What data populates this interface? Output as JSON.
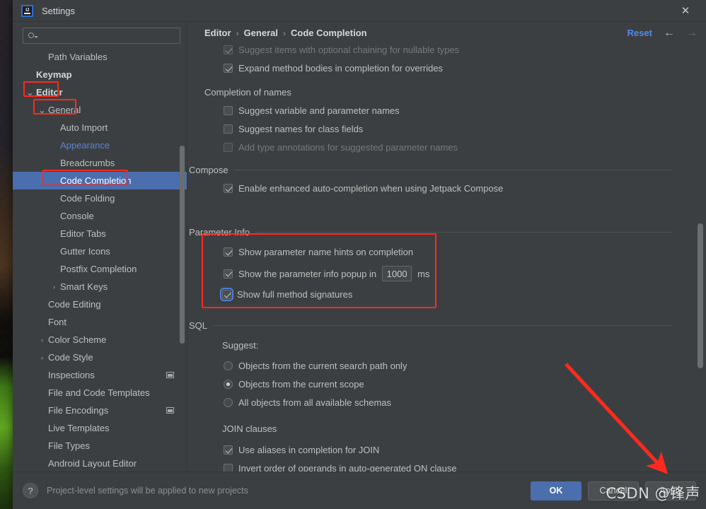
{
  "window": {
    "title": "Settings",
    "logo_text": "IJ",
    "close_icon": "✕"
  },
  "search": {
    "value": "",
    "placeholder": ""
  },
  "sidebar": {
    "items": [
      {
        "label": "Path Variables",
        "indent": 1,
        "arrow": "none",
        "style": "normal"
      },
      {
        "label": "Keymap",
        "indent": 0,
        "arrow": "none",
        "style": "bold"
      },
      {
        "label": "Editor",
        "indent": 0,
        "arrow": "down",
        "style": "bold"
      },
      {
        "label": "General",
        "indent": 1,
        "arrow": "down",
        "style": "normal"
      },
      {
        "label": "Auto Import",
        "indent": 2,
        "arrow": "none",
        "style": "normal"
      },
      {
        "label": "Appearance",
        "indent": 2,
        "arrow": "none",
        "style": "link"
      },
      {
        "label": "Breadcrumbs",
        "indent": 2,
        "arrow": "none",
        "style": "normal"
      },
      {
        "label": "Code Completion",
        "indent": 2,
        "arrow": "none",
        "style": "selected"
      },
      {
        "label": "Code Folding",
        "indent": 2,
        "arrow": "none",
        "style": "normal"
      },
      {
        "label": "Console",
        "indent": 2,
        "arrow": "none",
        "style": "normal"
      },
      {
        "label": "Editor Tabs",
        "indent": 2,
        "arrow": "none",
        "style": "normal"
      },
      {
        "label": "Gutter Icons",
        "indent": 2,
        "arrow": "none",
        "style": "normal"
      },
      {
        "label": "Postfix Completion",
        "indent": 2,
        "arrow": "none",
        "style": "normal"
      },
      {
        "label": "Smart Keys",
        "indent": 2,
        "arrow": "right",
        "style": "normal"
      },
      {
        "label": "Code Editing",
        "indent": 1,
        "arrow": "none",
        "style": "normal"
      },
      {
        "label": "Font",
        "indent": 1,
        "arrow": "none",
        "style": "normal"
      },
      {
        "label": "Color Scheme",
        "indent": 1,
        "arrow": "right",
        "style": "normal"
      },
      {
        "label": "Code Style",
        "indent": 1,
        "arrow": "right",
        "style": "normal"
      },
      {
        "label": "Inspections",
        "indent": 1,
        "arrow": "none",
        "style": "normal",
        "badge": true
      },
      {
        "label": "File and Code Templates",
        "indent": 1,
        "arrow": "none",
        "style": "normal"
      },
      {
        "label": "File Encodings",
        "indent": 1,
        "arrow": "none",
        "style": "normal",
        "badge": true
      },
      {
        "label": "Live Templates",
        "indent": 1,
        "arrow": "none",
        "style": "normal"
      },
      {
        "label": "File Types",
        "indent": 1,
        "arrow": "none",
        "style": "normal"
      },
      {
        "label": "Android Layout Editor",
        "indent": 1,
        "arrow": "none",
        "style": "normal"
      }
    ]
  },
  "main": {
    "breadcrumb": [
      "Editor",
      "General",
      "Code Completion"
    ],
    "breadcrumb_separator": "›",
    "reset_label": "Reset",
    "back_icon": "←",
    "forward_icon": "→",
    "options": [
      {
        "type": "checkbox",
        "label": "Suggest items with optional chaining for nullable types",
        "checked": true,
        "enabled": false,
        "indent": true,
        "clipped": true
      },
      {
        "type": "checkbox",
        "label": "Expand method bodies in completion for overrides",
        "checked": true,
        "enabled": true,
        "indent": true
      }
    ],
    "group_completion_of_names": {
      "title": "Completion of names",
      "options": [
        {
          "type": "checkbox",
          "label": "Suggest variable and parameter names",
          "checked": false,
          "enabled": true
        },
        {
          "type": "checkbox",
          "label": "Suggest names for class fields",
          "checked": false,
          "enabled": true
        },
        {
          "type": "checkbox",
          "label": "Add type annotations for suggested parameter names",
          "checked": false,
          "enabled": false
        }
      ]
    },
    "group_compose": {
      "title": "Compose",
      "options": [
        {
          "type": "checkbox",
          "label": "Enable enhanced auto-completion when using Jetpack Compose",
          "checked": true,
          "enabled": true
        }
      ]
    },
    "group_parameter_info": {
      "title": "Parameter Info",
      "options": [
        {
          "type": "checkbox",
          "label": "Show parameter name hints on completion",
          "checked": true,
          "enabled": true
        },
        {
          "type": "checkbox-spinner",
          "label": "Show the parameter info popup in",
          "checked": true,
          "enabled": true,
          "value": "1000",
          "unit": "ms"
        },
        {
          "type": "checkbox",
          "label": "Show full method signatures",
          "checked": true,
          "enabled": true,
          "focused": true
        }
      ]
    },
    "group_sql": {
      "title": "SQL",
      "suggest_label": "Suggest:",
      "radios": [
        {
          "label": "Objects from the current search path only",
          "selected": false
        },
        {
          "label": "Objects from the current scope",
          "selected": true
        },
        {
          "label": "All objects from all available schemas",
          "selected": false
        }
      ],
      "join_title": "JOIN clauses",
      "join_options": [
        {
          "type": "checkbox",
          "label": "Use aliases in completion for JOIN",
          "checked": true,
          "enabled": true
        },
        {
          "type": "checkbox",
          "label": "Invert order of operands in auto-generated ON clause",
          "checked": false,
          "enabled": true
        }
      ]
    }
  },
  "footer": {
    "help_icon": "?",
    "note": "Project-level settings will be applied to new projects",
    "ok_label": "OK",
    "cancel_label": "Cancel",
    "apply_label": "Apply"
  },
  "annotations": {
    "highlight_color": "#ff2a1e",
    "watermark": "CSDN @锋声"
  }
}
